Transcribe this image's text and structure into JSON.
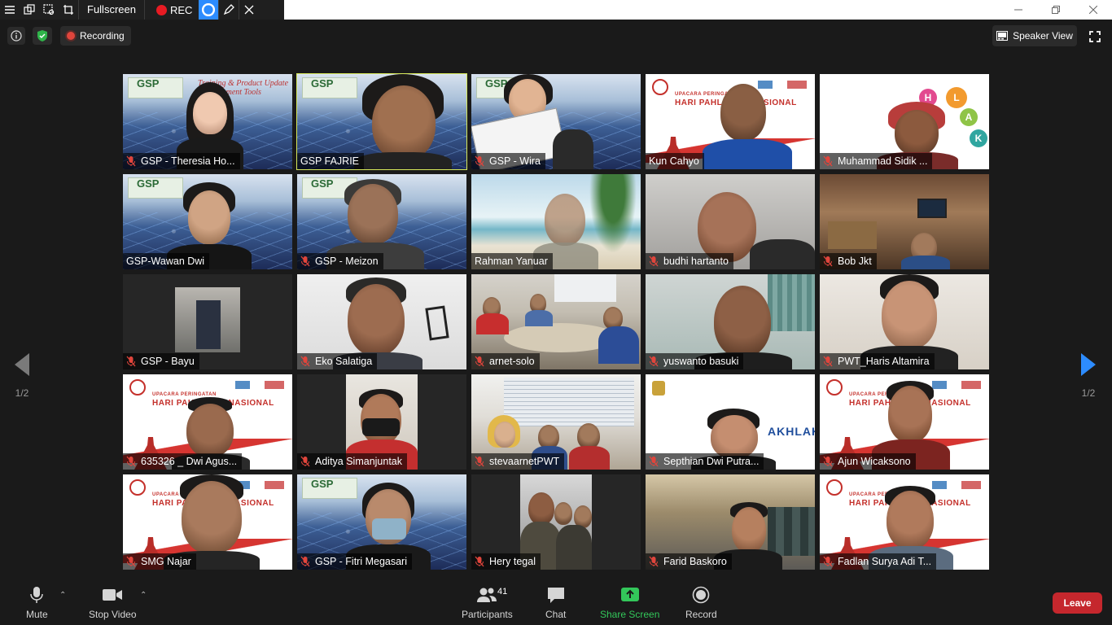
{
  "recorder_toolbar": {
    "fullscreen_label": "Fullscreen",
    "rec_label": "REC"
  },
  "header": {
    "recording_label": "Recording",
    "speaker_view_label": "Speaker View"
  },
  "gallery": {
    "page_left": "1/2",
    "page_right": "1/2",
    "tiles": [
      {
        "name": "GSP - Theresia Ho...",
        "muted": true
      },
      {
        "name": "GSP FAJRIE",
        "muted": false,
        "active": true
      },
      {
        "name": "GSP - Wira",
        "muted": true
      },
      {
        "name": "Kun Cahyo",
        "muted": false
      },
      {
        "name": "Muhammad Sidik ...",
        "muted": true
      },
      {
        "name": "GSP-Wawan Dwi",
        "muted": false
      },
      {
        "name": "GSP - Meizon",
        "muted": true
      },
      {
        "name": "Rahman Yanuar",
        "muted": false
      },
      {
        "name": "budhi hartanto",
        "muted": true
      },
      {
        "name": "Bob Jkt",
        "muted": true
      },
      {
        "name": "GSP - Bayu",
        "muted": true
      },
      {
        "name": "Eko Salatiga",
        "muted": true
      },
      {
        "name": "arnet-solo",
        "muted": true
      },
      {
        "name": "yuswanto basuki",
        "muted": true
      },
      {
        "name": "PWT_Haris Altamira",
        "muted": true
      },
      {
        "name": "635326 _ Dwi Agus...",
        "muted": true
      },
      {
        "name": "Aditya Simanjuntak",
        "muted": true
      },
      {
        "name": "stevaarnetPWT",
        "muted": true
      },
      {
        "name": "Septhian Dwi Putra...",
        "muted": true
      },
      {
        "name": "Ajun Wicaksono",
        "muted": true
      },
      {
        "name": "SMG Najar",
        "muted": true
      },
      {
        "name": "GSP - Fitri Megasari",
        "muted": true
      },
      {
        "name": "Hery tegal",
        "muted": true
      },
      {
        "name": "Farid Baskoro",
        "muted": true
      },
      {
        "name": "Fadlan Surya Adi T...",
        "muted": true
      }
    ],
    "background_texts": {
      "gsp_logo": "GSP",
      "gsp_tagline_1": "Training & Product Update",
      "gsp_tagline_2": "Measurement Tools",
      "upacara_1": "UPACARA PERINGATAN",
      "upacara_2": "HARI PAHLAWAN NASIONAL",
      "akhlak": "AKHLAK",
      "hlak_h": "H",
      "hlak_l": "L",
      "hlak_a": "A",
      "hlak_k": "K"
    }
  },
  "bottom_toolbar": {
    "mute_label": "Mute",
    "stop_video_label": "Stop Video",
    "participants_label": "Participants",
    "participants_count": "41",
    "chat_label": "Chat",
    "share_screen_label": "Share Screen",
    "record_label": "Record",
    "leave_label": "Leave"
  },
  "colors": {
    "background": "#1a1a1a",
    "active_speaker_border": "#d7e85a",
    "share_green": "#33c75a",
    "leave_red": "#c5272d",
    "nav_arrow_blue": "#2d8cff",
    "rec_red": "#e81b23"
  },
  "icons": {
    "menu": "menu-icon",
    "mic_muted": "mic-muted-icon",
    "shield": "shield-icon",
    "info": "info-icon"
  }
}
